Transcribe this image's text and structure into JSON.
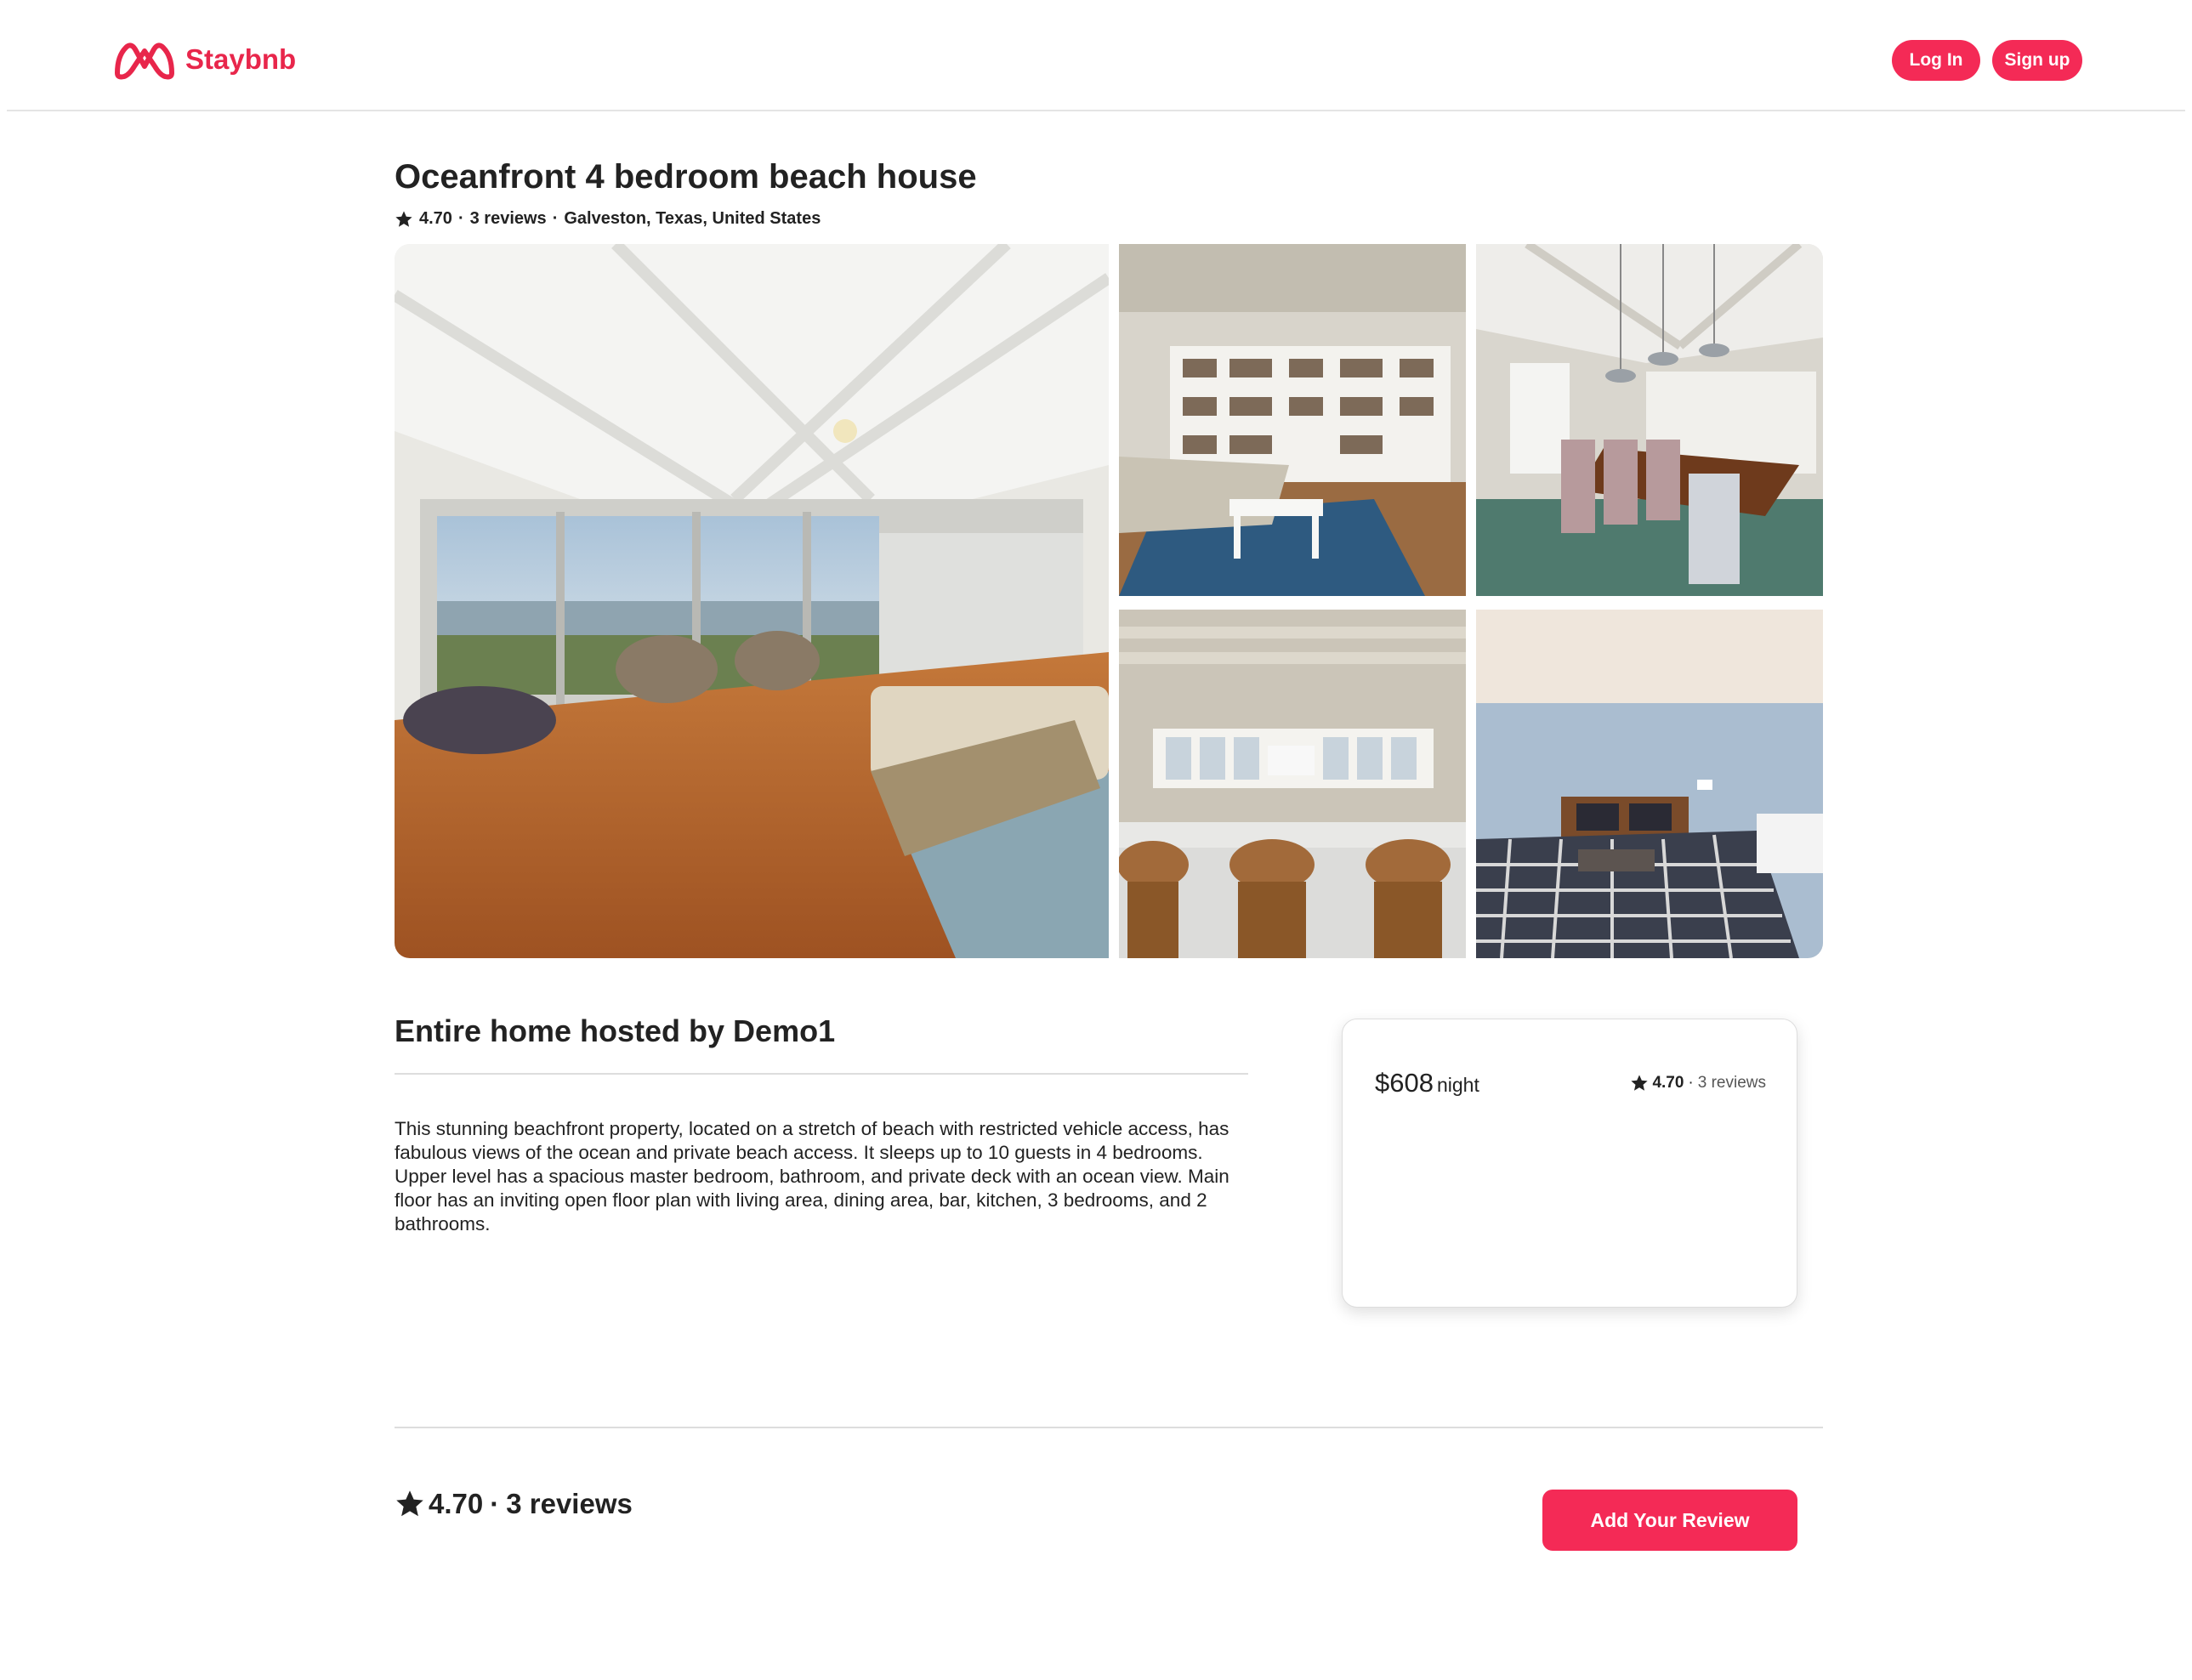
{
  "header": {
    "brand": "Staybnb",
    "brand_color": "#e8264b",
    "login_label": "Log In",
    "signup_label": "Sign up",
    "button_color": "#f42a56"
  },
  "listing": {
    "title": "Oceanfront 4 bedroom beach house",
    "rating": "4.70",
    "separator": "·",
    "reviews_label": "3 reviews",
    "location": "Galveston, Texas, United States",
    "photos": [
      {
        "name": "living-room-ocean-view-photo"
      },
      {
        "name": "living-room-bookshelf-photo"
      },
      {
        "name": "dining-room-photo"
      },
      {
        "name": "kitchen-bar-photo"
      },
      {
        "name": "bedroom-photo"
      }
    ]
  },
  "host": {
    "heading": "Entire home hosted by Demo1",
    "description": "This stunning beachfront property, located on a stretch of beach with restricted vehicle access, has fabulous views of the ocean and private beach access. It sleeps up to 10 guests in 4 bedrooms. Upper level has a spacious master bedroom, bathroom, and private deck with an ocean view. Main floor has an inviting open floor plan with living area, dining area, bar, kitchen, 3 bedrooms, and 2 bathrooms."
  },
  "booking": {
    "price": "$608",
    "unit": "night",
    "rating": "4.70",
    "separator": "·",
    "reviews_label": "3 reviews"
  },
  "reviews": {
    "rating": "4.70",
    "separator": "·",
    "count_label": "3 reviews",
    "add_button_label": "Add Your Review"
  },
  "icons": {
    "logo": "staybnb-logo-icon",
    "star": "star-icon"
  }
}
